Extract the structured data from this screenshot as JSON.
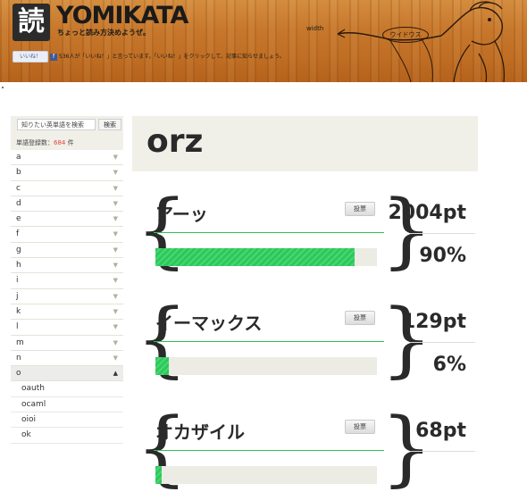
{
  "header": {
    "logo_char": "読",
    "logo_text": "YOMIKATA",
    "tagline": "ちょっと読み方決めようぜ。",
    "width_label": "width",
    "like_button": "いいね！",
    "like_count_text": "536人が「いいね！」と言っています。「いいね！」をクリックして、記事に知らせましょう。",
    "bubble_text": "ウイドウス"
  },
  "sidebar": {
    "search_placeholder": "知りたい英単語を検索",
    "search_button": "検索",
    "count_label": "単語登録数：",
    "count_value": "684",
    "count_unit": " 件",
    "letters": [
      "a",
      "b",
      "c",
      "d",
      "e",
      "f",
      "g",
      "h",
      "i",
      "j",
      "k",
      "l",
      "m",
      "n",
      "o"
    ],
    "open_letter": "o",
    "sub_items": [
      "oauth",
      "ocaml",
      "oioi",
      "ok"
    ]
  },
  "main": {
    "title": "orz",
    "vote_label": "投票",
    "entries": [
      {
        "word": "アーッ",
        "points": "2004pt",
        "percent": "90%",
        "fill": 0.9
      },
      {
        "word": "イーマックス",
        "points": "129pt",
        "percent": "6%",
        "fill": 0.06
      },
      {
        "word": "オカザイル",
        "points": "68pt",
        "percent": "",
        "fill": 0.03
      }
    ]
  },
  "colors": {
    "bar_green": "#2fc75b",
    "count_red": "#e5433d",
    "panel_bg": "#f0f0e9"
  }
}
